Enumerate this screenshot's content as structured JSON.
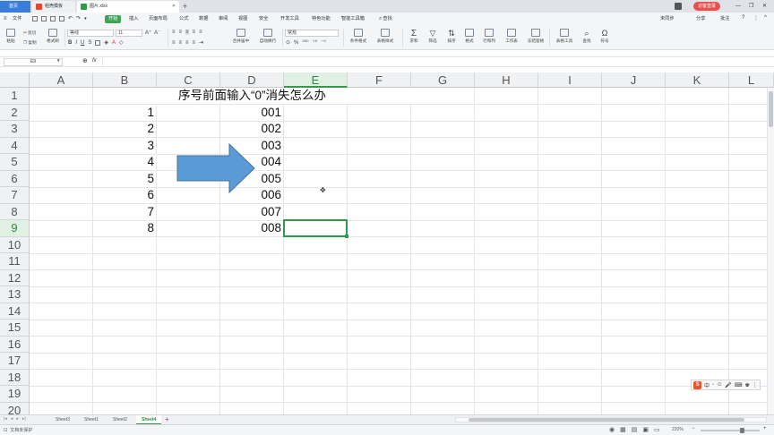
{
  "tabs": [
    {
      "label": "首页"
    },
    {
      "label": "稻壳模板"
    },
    {
      "label": "图片.xlsx"
    }
  ],
  "window": {
    "new_tab": "+",
    "login_button": "访客登录",
    "minimize": "—",
    "maximize": "❐",
    "close": "✕"
  },
  "menu": {
    "file": "文件",
    "items": [
      "开始",
      "插入",
      "页面布局",
      "公式",
      "数据",
      "审阅",
      "视图",
      "安全",
      "开发工具",
      "特色功能",
      "智能工具箱"
    ],
    "search": "查找",
    "sync": "未同步",
    "share": "分享",
    "comment": "批注"
  },
  "ribbon": {
    "paste": "粘贴",
    "cut": "剪切",
    "copy": "复制",
    "format_painter": "格式刷",
    "font_name": "等线",
    "font_size": "11",
    "merge_center": "合并居中",
    "wrap": "自动换行",
    "number_format": "常规",
    "conditional": "条件格式",
    "table_style": "表格样式",
    "sum": "求和",
    "filter": "筛选",
    "sort": "排序",
    "format": "格式",
    "row_col": "行和列",
    "worksheet": "工作表",
    "freeze": "冻结窗格",
    "table_tools": "表格工具",
    "find": "查找",
    "symbol": "符号"
  },
  "formula_bar": {
    "name_box": "E9",
    "fx": "fx",
    "value": ""
  },
  "grid": {
    "columns": [
      "A",
      "B",
      "C",
      "D",
      "E",
      "F",
      "G",
      "H",
      "I",
      "J",
      "K",
      "L"
    ],
    "rows": [
      "1",
      "2",
      "3",
      "4",
      "5",
      "6",
      "7",
      "8",
      "9",
      "10",
      "11",
      "12",
      "13",
      "14",
      "15",
      "16",
      "17",
      "18",
      "19",
      "20"
    ],
    "selected_column": "E",
    "selected_row": "9",
    "title": "序号前面输入“0”消失怎么办",
    "col_b_values": [
      "1",
      "2",
      "3",
      "4",
      "5",
      "6",
      "7",
      "8"
    ],
    "col_d_values": [
      "001",
      "002",
      "003",
      "004",
      "005",
      "006",
      "007",
      "008"
    ]
  },
  "sheets": [
    "Sheet3",
    "Sheet1",
    "Sheet2",
    "Sheet4"
  ],
  "active_sheet": "Sheet4",
  "status": {
    "doc_protect": "文档未保护",
    "zoom": "220%"
  },
  "colors": {
    "accent": "#3aa755",
    "arrow": "#5b9bd5"
  }
}
